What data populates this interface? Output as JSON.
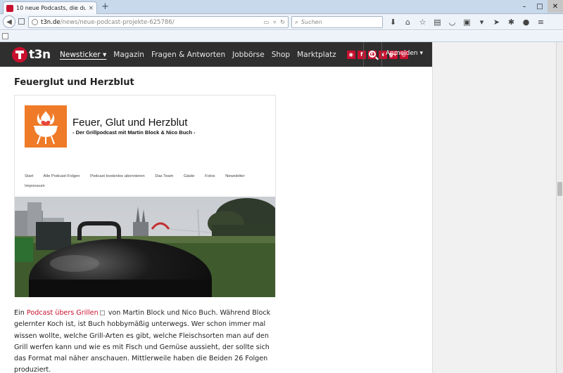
{
  "browser": {
    "tab_title": "10 neue Podcasts, die du di...",
    "tab_close": "×",
    "new_tab": "+",
    "url_domain": "t3n.de",
    "url_path": "/news/neue-podcast-projekte-625786/",
    "search_placeholder": "Suchen",
    "window": {
      "minimize": "–",
      "maximize": "□",
      "close": "✕"
    }
  },
  "site": {
    "logo_text": "t3n",
    "nav": [
      "Newsticker ▾",
      "Magazin",
      "Fragen & Antworten",
      "Jobbörse",
      "Shop",
      "Marktplatz"
    ],
    "social": [
      "rss",
      "f",
      "t",
      "x",
      "g+",
      "o"
    ],
    "login": "Anmelden ▾"
  },
  "article": {
    "heading": "Feuerglut und Herzblut",
    "embed": {
      "title": "Feuer, Glut und Herzblut",
      "subtitle": "- Der Grillpodcast mit Martin Block & Nico Buch -",
      "nav": [
        "Start",
        "Alle Podcast-Folgen",
        "Podcast kostenlos abonnieren",
        "Das Team",
        "Gäste",
        "Fotos",
        "Newsletter",
        "Impressum"
      ]
    },
    "link_text": "Podcast übers Grillen",
    "body_after_link": "von Martin Block und Nico Buch. Während Block gelernter Koch ist, ist Buch hobbymäßig unterwegs. Wer schon immer mal wissen wollte, welche Grill-Arten es gibt, welche Fleischsorten man auf den Grill werfen kann und wie es mit Fisch und Gemüse aussieht, der sollte sich das Format mal näher anschauen. Mittlerweile haben die Beiden 26 Folgen produziert.",
    "body_prefix": "Ein"
  },
  "colors": {
    "brand_red": "#c8102e",
    "header_dark": "#2f2f2f",
    "podcast_orange": "#ef7a28"
  }
}
